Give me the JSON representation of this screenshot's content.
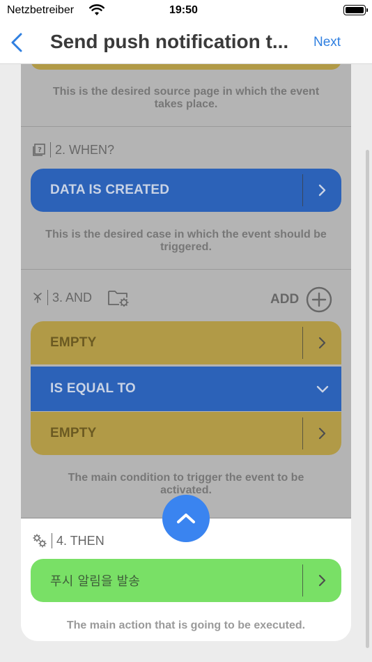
{
  "status_bar": {
    "carrier": "Netzbetreiber",
    "time": "19:50"
  },
  "nav": {
    "title": "Send push notification t...",
    "next_label": "Next"
  },
  "sections": {
    "source": {
      "description": "This is the desired source page in which the event takes place."
    },
    "when": {
      "title": "2. WHEN?",
      "button_label": "DATA IS CREATED",
      "description": "This is the desired case in which the event should be triggered."
    },
    "and": {
      "title": "3. AND",
      "add_label": "ADD",
      "condition_left": "EMPTY",
      "operator": "IS EQUAL TO",
      "condition_right": "EMPTY",
      "description": "The main condition to trigger the event to be activated."
    },
    "then": {
      "title": "4. THEN",
      "button_label": "푸시 알림을 발송",
      "description": "The main action that is going to be executed."
    }
  },
  "colors": {
    "accent": "#2f7fe0",
    "blue_button": "#2c62b8",
    "gold_button": "#b19a47",
    "green_button": "#79e066",
    "fab": "#3a84f0"
  }
}
